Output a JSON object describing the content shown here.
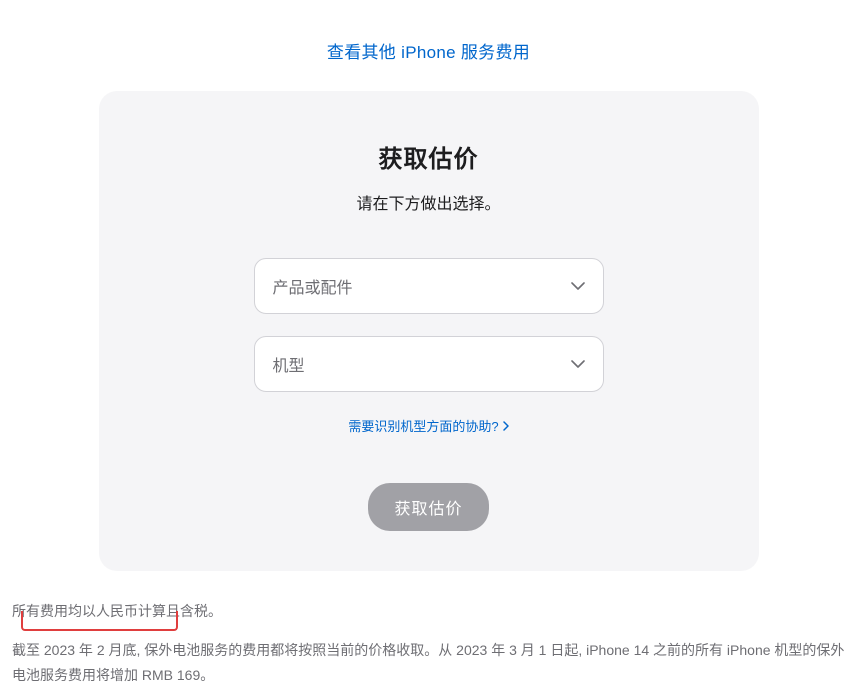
{
  "topLink": {
    "label": "查看其他 iPhone 服务费用"
  },
  "card": {
    "title": "获取估价",
    "subtitle": "请在下方做出选择。",
    "select1": {
      "placeholder": "产品或配件"
    },
    "select2": {
      "placeholder": "机型"
    },
    "helpLink": {
      "label": "需要识别机型方面的协助?"
    },
    "submitButton": {
      "label": "获取估价"
    }
  },
  "footer": {
    "line1": "所有费用均以人民币计算且含税。",
    "line2_part1": "截至 2023 年 2 月底, 保外电池服务的费用都将按照当前的价格收取。从 2023 年 3 月 1 日起, iPhone 14 之前的所有 iPhone 机型的保外电池服务",
    "line2_highlight": "费用将增加 RMB 169。"
  }
}
